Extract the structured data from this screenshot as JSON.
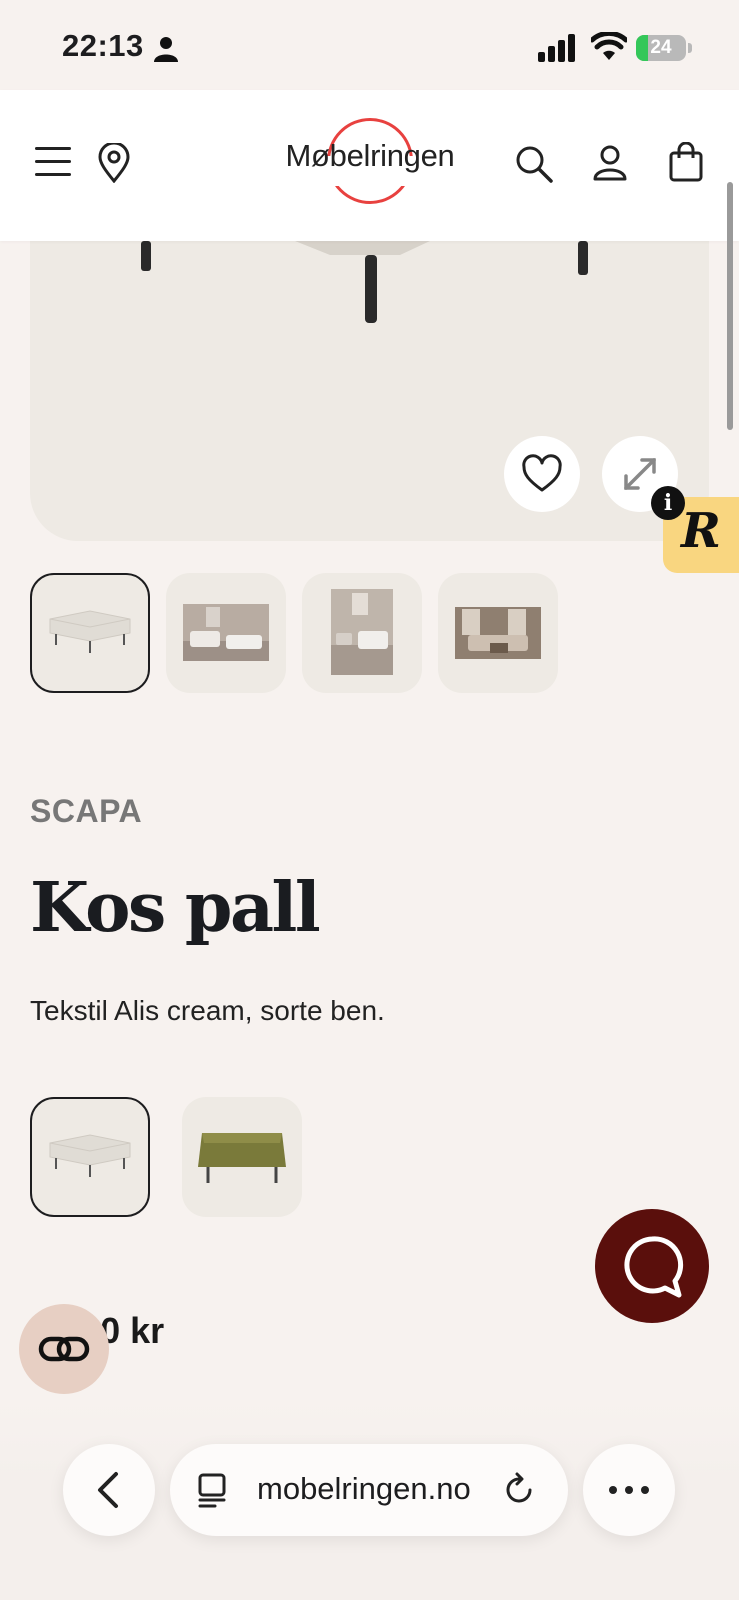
{
  "status_bar": {
    "time": "22:13",
    "battery_level": "24",
    "battery_fraction": 0.24,
    "battery_color": "#34c759"
  },
  "header": {
    "logo_text": "Møbelringen",
    "logo_color": "#e8413f",
    "icons": [
      "menu-icon",
      "location-pin-icon",
      "search-icon",
      "account-icon",
      "shopping-bag-icon"
    ]
  },
  "product": {
    "brand": "SCAPA",
    "title": "Kos pall",
    "description": "Tekstil Alis cream, sorte ben.",
    "price_visible": "99,00 kr",
    "thumbnails": [
      "ottoman",
      "living-room-1",
      "living-room-2",
      "living-room-3"
    ],
    "variants": [
      "cream",
      "olive"
    ]
  },
  "overlays": {
    "r_badge_letter": "R",
    "info_letter": "i",
    "chat_color": "#5a0f0c"
  },
  "browser": {
    "url": "mobelringen.no"
  }
}
